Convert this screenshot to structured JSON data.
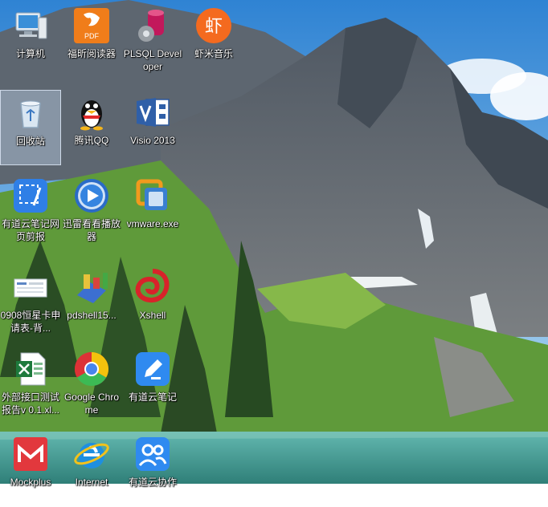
{
  "desktop": {
    "icons": [
      {
        "label": "计算机",
        "icon": "computer-icon"
      },
      {
        "label": "福昕阅读器",
        "icon": "foxit-pdf-icon"
      },
      {
        "label": "PLSQL Developer",
        "icon": "plsql-developer-icon"
      },
      {
        "label": "虾米音乐",
        "icon": "xiami-music-icon"
      },
      {
        "label": "回收站",
        "icon": "recycle-bin-icon"
      },
      {
        "label": "腾讯QQ",
        "icon": "qq-penguin-icon"
      },
      {
        "label": "Visio 2013",
        "icon": "visio-icon"
      },
      {
        "label": "有道云笔记网页剪报",
        "icon": "youdao-web-clipper-icon"
      },
      {
        "label": "迅雷看看播放器",
        "icon": "xunlei-player-icon"
      },
      {
        "label": "vmware.exe",
        "icon": "vmware-icon"
      },
      {
        "label": "0908恒星卡申请表-背...",
        "icon": "document-thumbnail-icon"
      },
      {
        "label": "pdshell15...",
        "icon": "pdshell-icon"
      },
      {
        "label": "Xshell",
        "icon": "xshell-icon"
      },
      {
        "label": "外部接口测试报告v 0.1.xl...",
        "icon": "excel-file-icon"
      },
      {
        "label": "Google Chrome",
        "icon": "chrome-icon"
      },
      {
        "label": "有道云笔记",
        "icon": "youdao-note-icon"
      },
      {
        "label": "Mockplus",
        "icon": "mockplus-icon"
      },
      {
        "label": "Internet",
        "icon": "internet-explorer-icon"
      },
      {
        "label": "有道云协作",
        "icon": "youdao-collab-icon"
      }
    ]
  },
  "colors": {
    "sky_top": "#3f8fd6",
    "sky_bottom": "#bfe1f5",
    "rock": "#6c727a",
    "grass": "#6fa83e",
    "lake": "#4ea6a0"
  }
}
